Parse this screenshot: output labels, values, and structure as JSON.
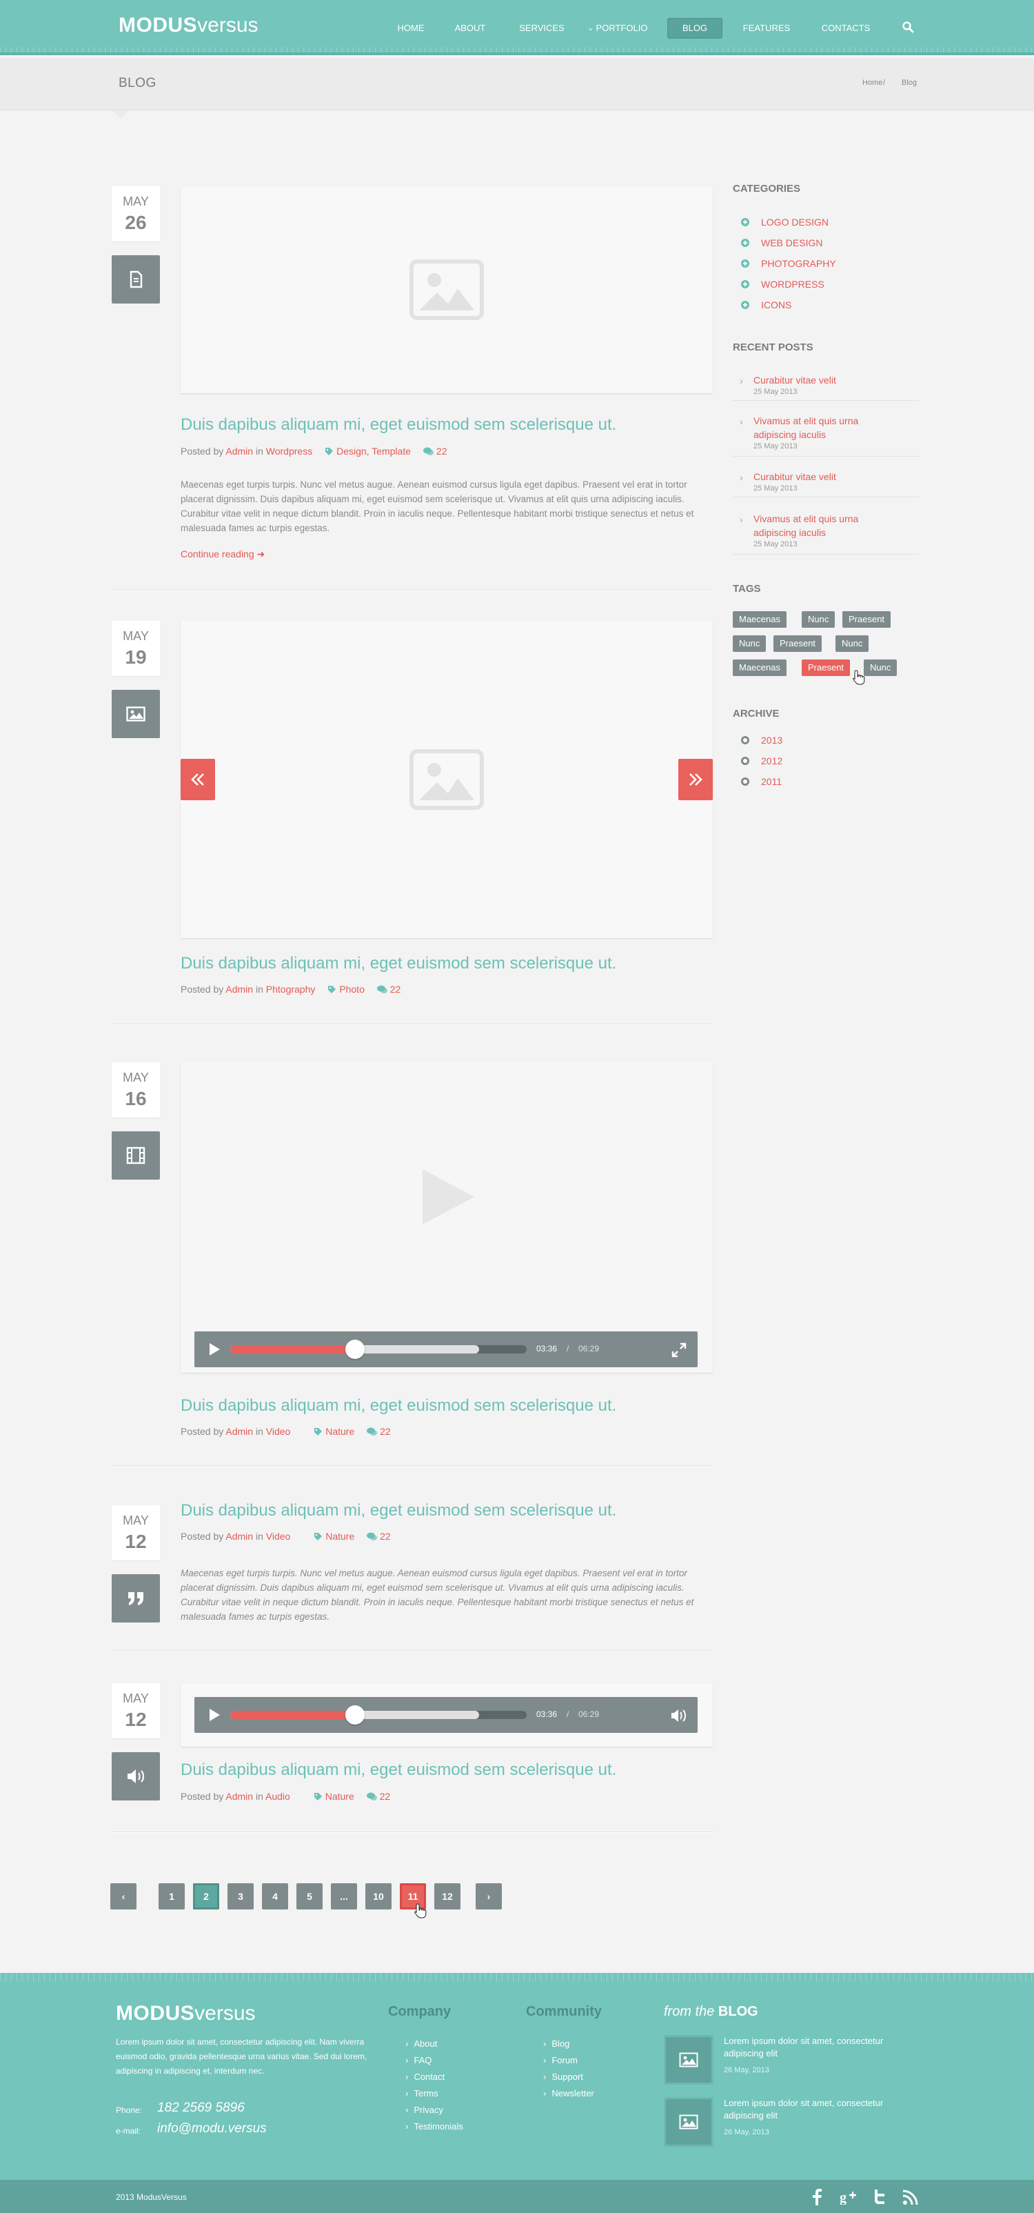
{
  "header": {
    "logo_bold": "MODUS",
    "logo_light": "versus",
    "nav": [
      "HOME",
      "ABOUT",
      "SERVICES",
      "PORTFOLIO",
      "BLOG",
      "FEATURES",
      "CONTACTS"
    ],
    "active_nav": "BLOG"
  },
  "titlebar": {
    "title": "BLOG",
    "breadcrumb_home": "Home",
    "breadcrumb_sep": "/",
    "breadcrumb_current": "Blog"
  },
  "posts": [
    {
      "month": "MAY",
      "day": "26",
      "type_icon": "document-icon",
      "title": "Duis dapibus aliquam mi, eget euismod sem scelerisque ut.",
      "posted_by": "Posted by",
      "author": "Admin",
      "in": "in",
      "category": "Wordpress",
      "tags": "Design, Template",
      "comments": "22",
      "excerpt": "Maecenas eget turpis turpis. Nunc vel metus augue. Aenean euismod cursus ligula eget dapibus. Praesent vel erat in tortor placerat dignissim. Duis dapibus aliquam mi, eget euismod sem scelerisque ut. Vivamus at elit quis urna adipiscing iaculis. Curabitur vitae velit in neque dictum blandit. Proin in iaculis neque. Pellentesque habitant morbi tristique senectus et netus et malesuada fames ac turpis egestas.",
      "continue": "Continue reading"
    },
    {
      "month": "MAY",
      "day": "19",
      "type_icon": "image-icon",
      "title": "Duis dapibus aliquam mi, eget euismod sem scelerisque ut.",
      "posted_by": "Posted by",
      "author": "Admin",
      "in": "in",
      "category": "Phtography",
      "tags": "Photo",
      "comments": "22"
    },
    {
      "month": "MAY",
      "day": "16",
      "type_icon": "film-icon",
      "title": "Duis dapibus aliquam mi, eget euismod sem scelerisque ut.",
      "posted_by": "Posted by",
      "author": "Admin",
      "in": "in",
      "category": "Video",
      "tags": "Nature",
      "comments": "22",
      "player": {
        "current": "03:36",
        "sep": "/",
        "total": "06:29",
        "progress": 0.42,
        "buffered": 0.84
      }
    },
    {
      "month": "MAY",
      "day": "12",
      "type_icon": "quote-icon",
      "title": "Duis dapibus aliquam mi, eget euismod sem scelerisque ut.",
      "posted_by": "Posted by",
      "author": "Admin",
      "in": "in",
      "category": "Video",
      "tags": "Nature",
      "comments": "22",
      "quote": "Maecenas eget turpis turpis. Nunc vel metus augue. Aenean euismod cursus ligula eget dapibus. Praesent vel erat in tortor placerat dignissim. Duis dapibus aliquam mi, eget euismod sem scelerisque ut. Vivamus at elit quis urna adipiscing iaculis. Curabitur vitae velit in neque dictum blandit. Proin in iaculis neque. Pellentesque habitant morbi tristique senectus et netus et malesuada fames ac turpis egestas."
    },
    {
      "month": "MAY",
      "day": "12",
      "type_icon": "speaker-icon",
      "title": "Duis dapibus aliquam mi, eget euismod sem scelerisque ut.",
      "posted_by": "Posted by",
      "author": "Admin",
      "in": "in",
      "category": "Audio",
      "tags": "Nature",
      "comments": "22",
      "player": {
        "current": "03:36",
        "sep": "/",
        "total": "06:29",
        "progress": 0.42,
        "buffered": 0.84
      }
    }
  ],
  "sidebar": {
    "categories_title": "CATEGORIES",
    "categories": [
      "LOGO DESIGN",
      "WEB DESIGN",
      "PHOTOGRAPHY",
      "WORDPRESS",
      "ICONS"
    ],
    "recent_title": "RECENT POSTS",
    "recent": [
      {
        "title": "Curabitur vitae velit",
        "date": "25 May 2013"
      },
      {
        "title": "Vivamus at elit quis urna adipiscing iaculis",
        "date": "25 May 2013"
      },
      {
        "title": "Curabitur vitae velit",
        "date": "25 May 2013"
      },
      {
        "title": "Vivamus at elit quis urna adipiscing iaculis",
        "date": "25 May 2013"
      }
    ],
    "tags_title": "TAGS",
    "tags": [
      "Maecenas",
      "Nunc",
      "Praesent",
      "Nunc",
      "Praesent",
      "Nunc",
      "Maecenas",
      "Praesent",
      "Nunc"
    ],
    "highlighted_tag_index": 7,
    "archive_title": "ARCHIVE",
    "archive": [
      "2013",
      "2012",
      "2011"
    ]
  },
  "pagination": {
    "prev": "‹",
    "next": "›",
    "pages": [
      "1",
      "2",
      "3",
      "4",
      "5",
      "...",
      "10",
      "11",
      "12"
    ],
    "current": "2",
    "hovered": "11"
  },
  "footer": {
    "logo_bold": "MODUS",
    "logo_light": "versus",
    "about": "Lorem ipsum dolor sit amet, consectetur adipiscing elit. Nam viverra euismod odio, gravida pellentesque urna varius vitae. Sed dui lorem, adipiscing in adipiscing et, interdum nec.",
    "phone_label": "Phone:",
    "phone": "182 2569 5896",
    "email_label": "e-mail:",
    "email": "info@modu.versus",
    "company_title": "Company",
    "company_links": [
      "About",
      "FAQ",
      "Contact",
      "Terms",
      "Privacy",
      "Testimonials"
    ],
    "community_title": "Community",
    "community_links": [
      "Blog",
      "Forum",
      "Support",
      "Newsletter"
    ],
    "blog_title_pre": "from the",
    "blog_title": "BLOG",
    "blog_items": [
      {
        "text": "Lorem ipsum dolor sit amet, consectetur adipiscing elit",
        "date": "26 May, 2013"
      },
      {
        "text": "Lorem ipsum dolor sit amet, consectetur adipiscing elit",
        "date": "26 May, 2013"
      }
    ],
    "copyright": "2013  ModusVersus",
    "social": [
      "facebook-icon",
      "google-plus-icon",
      "twitter-icon",
      "rss-icon"
    ]
  },
  "colors": {
    "teal": "#74c5bc",
    "accent": "#e35a57",
    "gray": "#7f8a8c"
  }
}
